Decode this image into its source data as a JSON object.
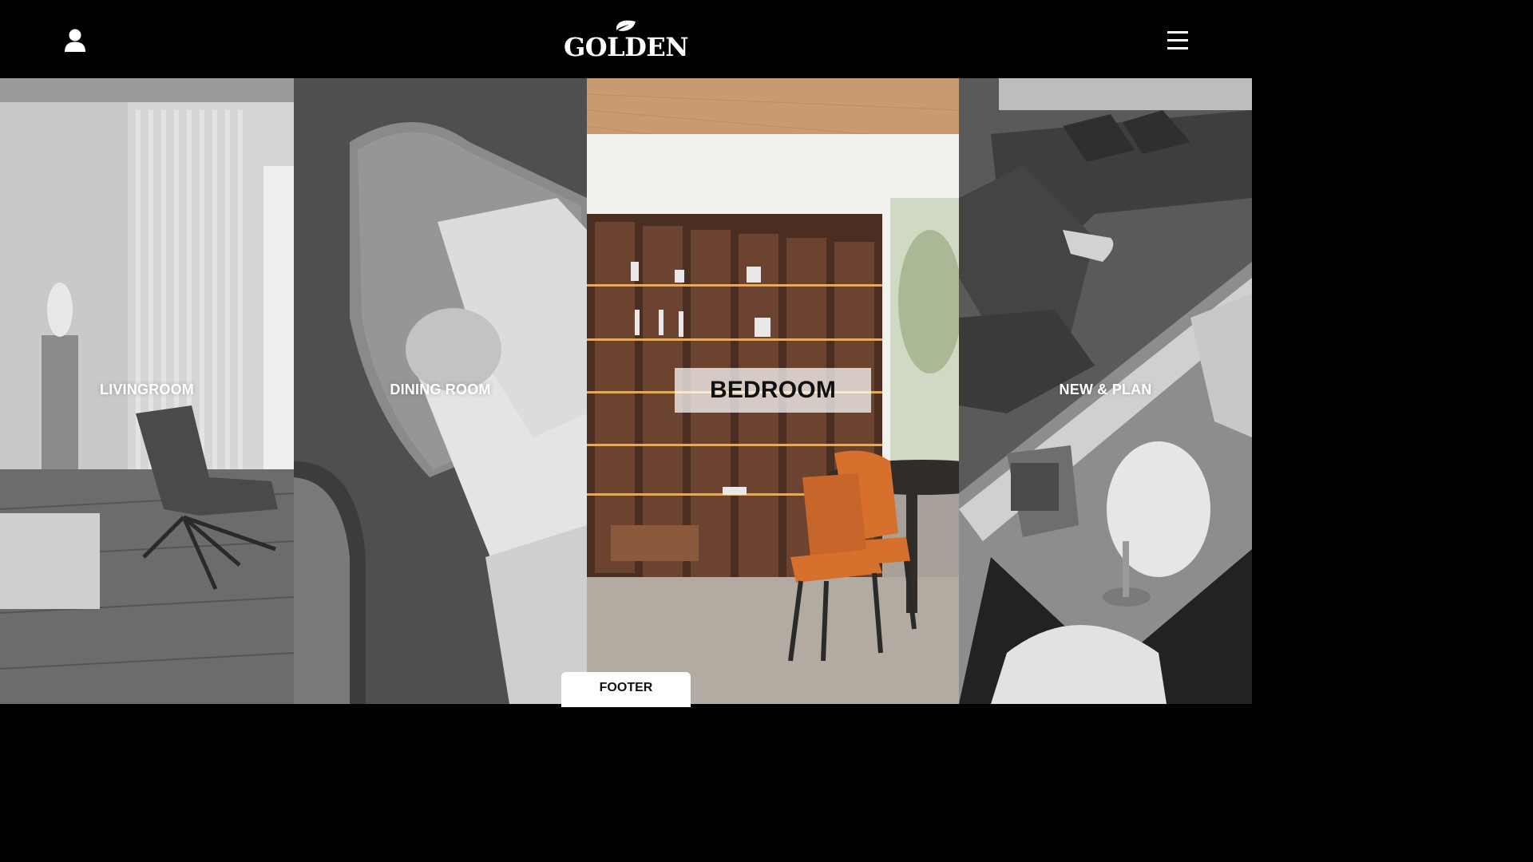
{
  "header": {
    "logo_text": "GOLDEN",
    "user_icon": "user-icon",
    "menu_icon": "hamburger-menu-icon"
  },
  "panels": [
    {
      "label": "LIVINGROOM",
      "active": false
    },
    {
      "label": "DINING ROOM",
      "active": false
    },
    {
      "label": "BEDROOM",
      "active": true
    },
    {
      "label": "NEW & PLAN",
      "active": false
    }
  ],
  "footer": {
    "label": "FOOTER"
  },
  "colors": {
    "header_bg": "#000000",
    "accent_orange": "#d8702d",
    "wood": "#c89a70"
  }
}
